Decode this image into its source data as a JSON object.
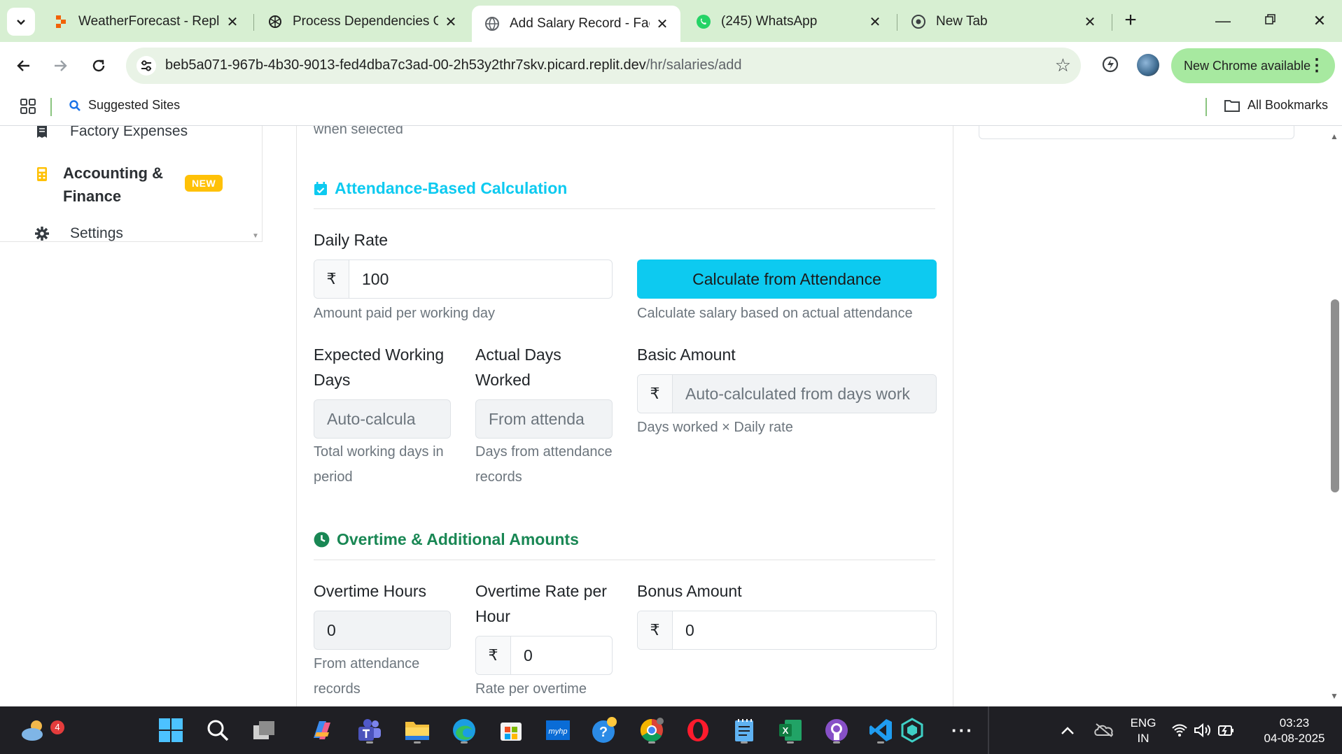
{
  "browser": {
    "tabs": [
      {
        "title": "WeatherForecast - Replit",
        "icon": "replit-icon"
      },
      {
        "title": "Process Dependencies O",
        "icon": "openai-icon"
      },
      {
        "title": "Add Salary Record - Facto",
        "icon": "globe-icon",
        "active": true
      },
      {
        "title": "(245) WhatsApp",
        "icon": "whatsapp-icon"
      },
      {
        "title": "New Tab",
        "icon": "chrome-icon"
      }
    ],
    "url_host": "beb5a071-967b-4b30-9013-fed4dba7c3ad-00-2h53y2thr7skv.picard.replit.dev",
    "url_path": "/hr/salaries/add",
    "update_label": "New Chrome available",
    "bookmarks": {
      "suggested": "Suggested Sites",
      "all": "All Bookmarks"
    }
  },
  "sidebar": {
    "items": [
      {
        "label": "Factory Expenses",
        "icon": "receipt-icon"
      },
      {
        "label": "Accounting & Finance",
        "icon": "calculator-icon",
        "badge": "NEW"
      },
      {
        "label": "Settings",
        "icon": "gear-icon"
      }
    ]
  },
  "form": {
    "clipped_help": "when selected",
    "attendance_section": {
      "title": "Attendance-Based Calculation",
      "color": "#0dcaf0",
      "daily_rate_label": "Daily Rate",
      "daily_rate_currency": "₹",
      "daily_rate_value": "100",
      "daily_rate_help": "Amount paid per working day",
      "calc_button": "Calculate from Attendance",
      "calc_help": "Calculate salary based on actual attendance",
      "expected_days_label": "Expected Working Days",
      "expected_days_placeholder": "Auto-calcula",
      "expected_days_help": "Total working days in period",
      "actual_days_label": "Actual Days Worked",
      "actual_days_placeholder": "From attenda",
      "actual_days_help": "Days from attendance records",
      "basic_amount_label": "Basic Amount",
      "basic_amount_currency": "₹",
      "basic_amount_placeholder": "Auto-calculated from days work",
      "basic_amount_help": "Days worked × Daily rate"
    },
    "overtime_section": {
      "title": "Overtime & Additional Amounts",
      "color": "#198754",
      "ot_hours_label": "Overtime Hours",
      "ot_hours_value": "0",
      "ot_hours_help": "From attendance records",
      "ot_rate_label": "Overtime Rate per Hour",
      "ot_rate_currency": "₹",
      "ot_rate_value": "0",
      "ot_rate_help": "Rate per overtime",
      "bonus_label": "Bonus Amount",
      "bonus_currency": "₹",
      "bonus_value": "0"
    }
  },
  "taskbar": {
    "weather_badge": "4",
    "lang_top": "ENG",
    "lang_bottom": "IN",
    "time": "03:23",
    "date": "04-08-2025"
  }
}
